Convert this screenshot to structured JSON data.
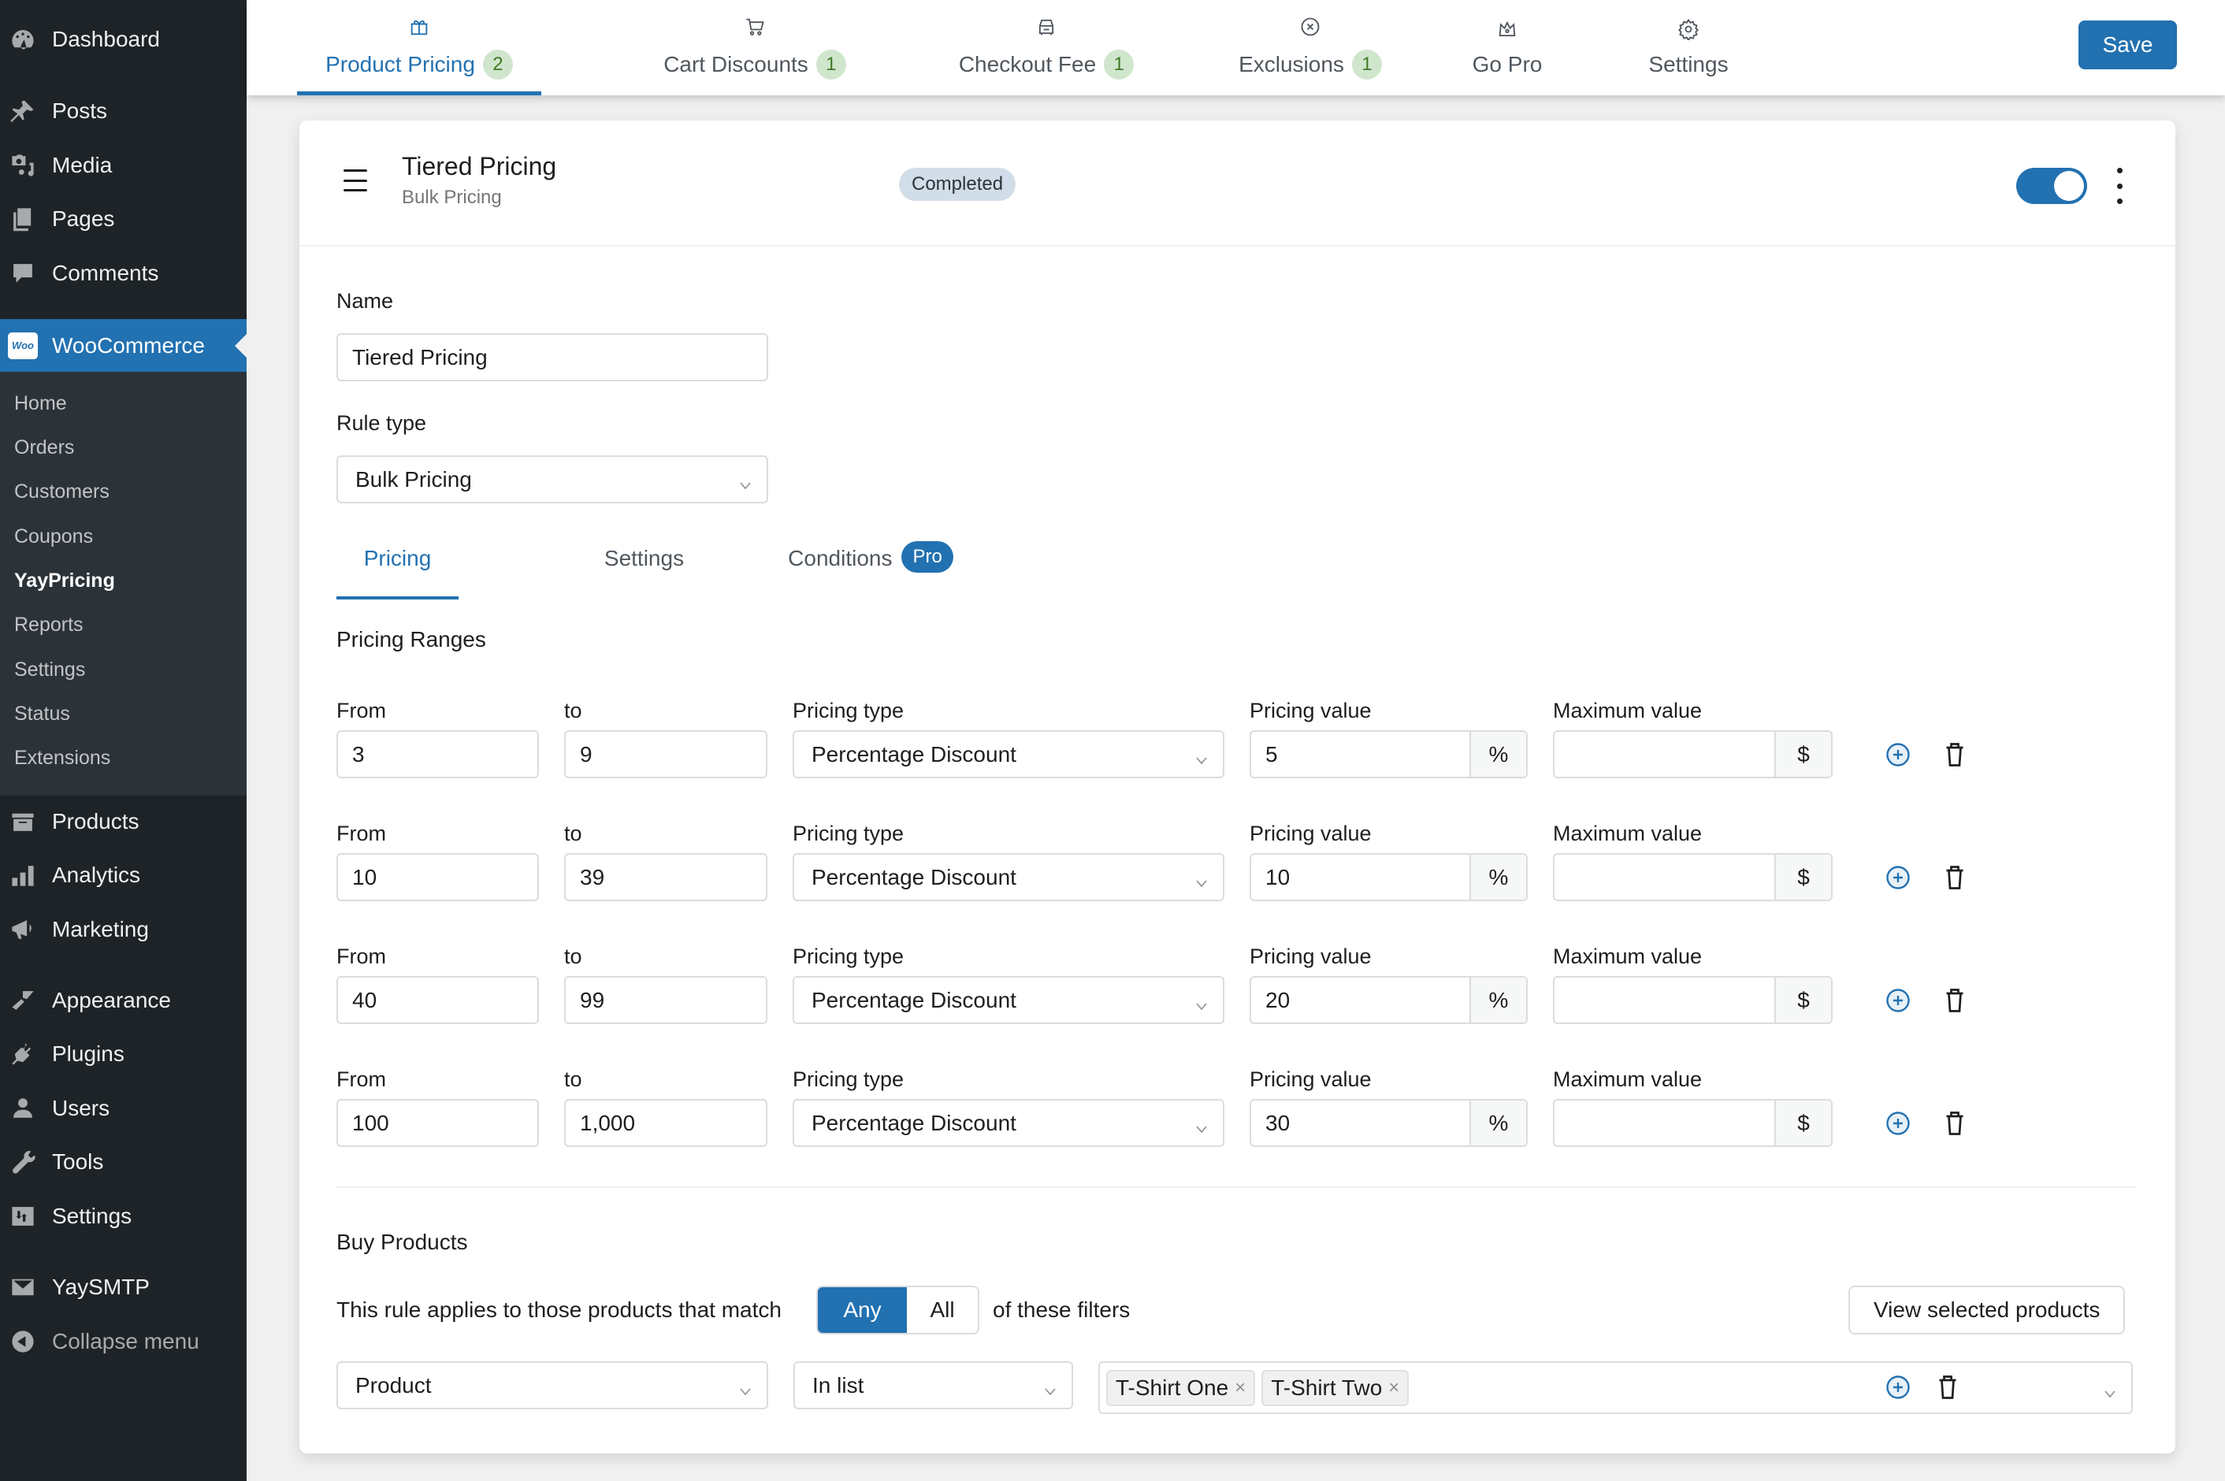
{
  "sidebar": {
    "items": [
      {
        "label": "Dashboard",
        "icon": "dashboard-icon"
      },
      {
        "label": "Posts",
        "icon": "pin-icon"
      },
      {
        "label": "Media",
        "icon": "media-icon"
      },
      {
        "label": "Pages",
        "icon": "pages-icon"
      },
      {
        "label": "Comments",
        "icon": "comment-icon"
      },
      {
        "label": "WooCommerce",
        "icon": "woo-icon"
      },
      {
        "label": "Products",
        "icon": "archive-icon"
      },
      {
        "label": "Analytics",
        "icon": "chart-bar-icon"
      },
      {
        "label": "Marketing",
        "icon": "megaphone-icon"
      },
      {
        "label": "Appearance",
        "icon": "paintbrush-icon"
      },
      {
        "label": "Plugins",
        "icon": "plugin-icon"
      },
      {
        "label": "Users",
        "icon": "user-icon"
      },
      {
        "label": "Tools",
        "icon": "wrench-icon"
      },
      {
        "label": "Settings",
        "icon": "sliders-icon"
      },
      {
        "label": "YaySMTP",
        "icon": "envelope-icon"
      },
      {
        "label": "Collapse menu",
        "icon": "collapse-icon"
      }
    ],
    "woo_icon_text": "Woo",
    "submenu": [
      "Home",
      "Orders",
      "Customers",
      "Coupons",
      "YayPricing",
      "Reports",
      "Settings",
      "Status",
      "Extensions"
    ],
    "current_submenu": "YayPricing"
  },
  "topnav": {
    "tabs": [
      {
        "label": "Product Pricing",
        "count": "2",
        "icon": "gift-icon",
        "active": true
      },
      {
        "label": "Cart Discounts",
        "count": "1",
        "icon": "cart-icon"
      },
      {
        "label": "Checkout Fee",
        "count": "1",
        "icon": "car-icon"
      },
      {
        "label": "Exclusions",
        "count": "1",
        "icon": "circle-x-icon"
      },
      {
        "label": "Go Pro",
        "icon": "crown-icon"
      },
      {
        "label": "Settings",
        "icon": "gear-icon"
      }
    ],
    "save_label": "Save"
  },
  "rule": {
    "title": "Tiered Pricing",
    "subtitle": "Bulk Pricing",
    "status": "Completed",
    "enabled": true,
    "name_label": "Name",
    "name_value": "Tiered Pricing",
    "rule_type_label": "Rule type",
    "rule_type_value": "Bulk Pricing",
    "tabs": [
      {
        "label": "Pricing",
        "active": true
      },
      {
        "label": "Settings"
      },
      {
        "label": "Conditions",
        "badge": "Pro"
      }
    ]
  },
  "pricing_ranges": {
    "title": "Pricing Ranges",
    "labels": {
      "from": "From",
      "to": "to",
      "type": "Pricing type",
      "value": "Pricing value",
      "max": "Maximum value"
    },
    "value_suffix": "%",
    "max_suffix": "$",
    "rows": [
      {
        "from": "3",
        "to": "9",
        "type": "Percentage Discount",
        "value": "5",
        "max": ""
      },
      {
        "from": "10",
        "to": "39",
        "type": "Percentage Discount",
        "value": "10",
        "max": ""
      },
      {
        "from": "40",
        "to": "99",
        "type": "Percentage Discount",
        "value": "20",
        "max": ""
      },
      {
        "from": "100",
        "to": "1,000",
        "type": "Percentage Discount",
        "value": "30",
        "max": ""
      }
    ]
  },
  "buy_products": {
    "title": "Buy Products",
    "match_prefix": "This rule applies to those products that match",
    "match_options": [
      "Any",
      "All"
    ],
    "match_selected": "Any",
    "match_suffix": "of these filters",
    "view_button": "View selected products",
    "filter": {
      "field": "Product",
      "operator": "In list",
      "values": [
        "T-Shirt One",
        "T-Shirt Two"
      ],
      "remove_glyph": "×"
    }
  },
  "colors": {
    "accent": "#2271b1",
    "sidebar_bg": "#1d2327",
    "count_badge_bg": "#cfe6cc",
    "count_badge_text": "#3f7a26",
    "status_badge_bg": "#d1dde8"
  }
}
